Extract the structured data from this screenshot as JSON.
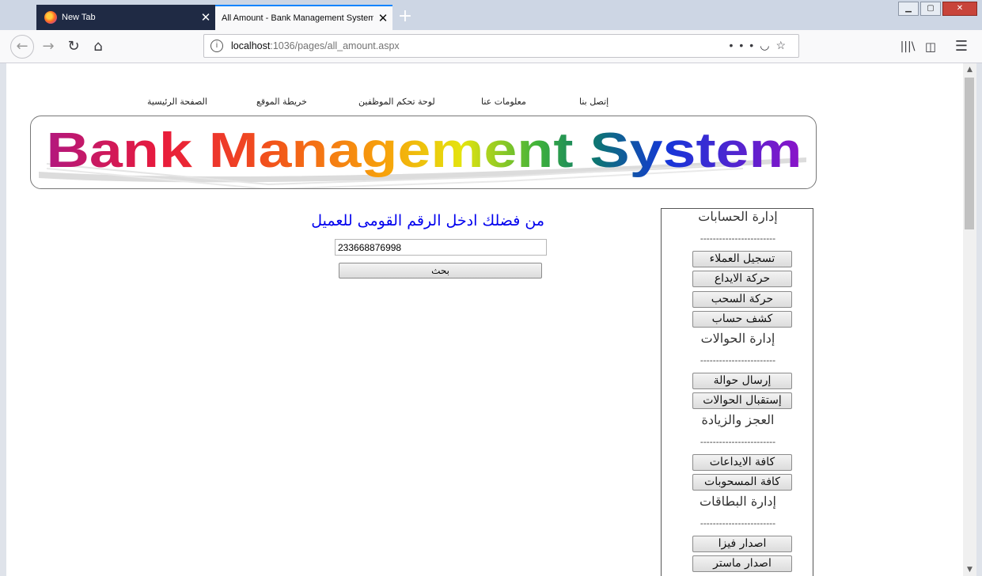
{
  "browser": {
    "tabs": [
      {
        "title": "New Tab"
      },
      {
        "title": "All Amount - Bank Management System"
      }
    ],
    "url_host": "localhost",
    "url_path": ":1036/pages/all_amount.aspx",
    "url_more_icon": "•••"
  },
  "site": {
    "top_nav": [
      "الصفحة الرئيسية",
      "خريطة الموقع",
      "لوحة تحكم الموظفين",
      "معلومات عنا",
      "إتصل بنا"
    ],
    "banner_title": "Bank Management System"
  },
  "main": {
    "prompt": "من فضلك ادخل الرقم القومى للعميل",
    "national_id_value": "233668876998",
    "search_label": "بحث"
  },
  "sidebar": {
    "separator": "------------------------",
    "sections": [
      {
        "title": "إدارة الحسابات",
        "buttons": [
          "تسجيل العملاء",
          "حركة الايداع",
          "حركة السحب",
          "كشف حساب"
        ]
      },
      {
        "title": "إدارة الحوالات",
        "buttons": [
          "إرسال حوالة",
          "إستقبال الحوالات"
        ]
      },
      {
        "title": "العجز والزيادة",
        "buttons": [
          "كافة الايداعات",
          "كافة المسحوبات"
        ]
      },
      {
        "title": "إدارة البطاقات",
        "buttons": [
          "اصدار فيزا",
          "اصدار ماستر"
        ]
      }
    ]
  }
}
